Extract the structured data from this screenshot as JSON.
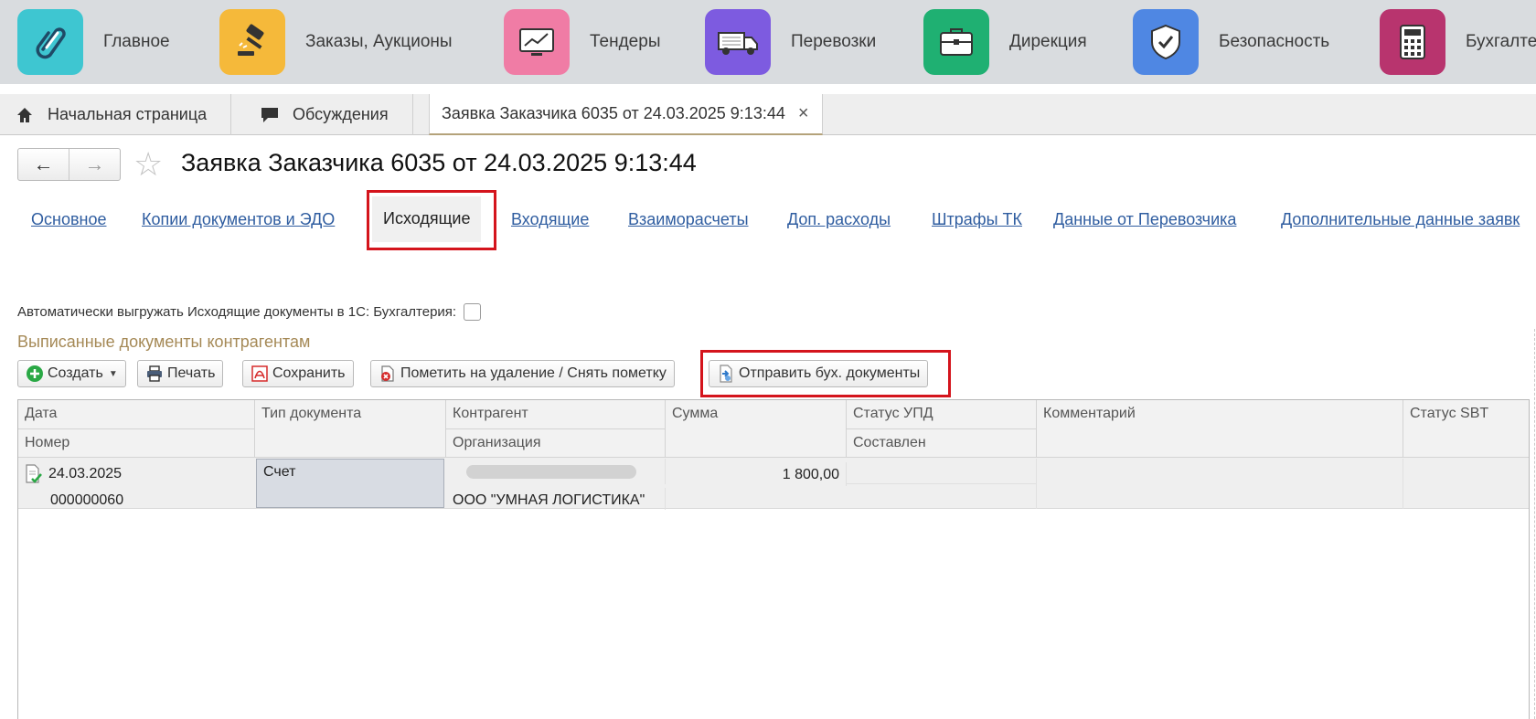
{
  "sections": [
    {
      "label": "Главное",
      "icon": "paperclip-icon",
      "color": "#3ec6d1"
    },
    {
      "label": "Заказы, Аукционы",
      "icon": "gavel-icon",
      "color": "#f5b93a"
    },
    {
      "label": "Тендеры",
      "icon": "chart-monitor-icon",
      "color": "#f07ca5"
    },
    {
      "label": "Перевозки",
      "icon": "truck-icon",
      "color": "#7d5be0"
    },
    {
      "label": "Дирекция",
      "icon": "briefcase-icon",
      "color": "#1fb072"
    },
    {
      "label": "Безопасность",
      "icon": "shield-check-icon",
      "color": "#4f87e3"
    },
    {
      "label": "Бухгалте",
      "icon": "calculator-icon",
      "color": "#b8346e"
    }
  ],
  "window_tabs": {
    "home": "Начальная страница",
    "discussions": "Обсуждения",
    "current": "Заявка Заказчика 6035 от 24.03.2025 9:13:44",
    "close": "×"
  },
  "title": "Заявка Заказчика 6035 от 24.03.2025 9:13:44",
  "nav": {
    "back": "←",
    "forward": "→",
    "star": "☆"
  },
  "form_tabs": [
    "Основное",
    "Копии документов и ЭДО",
    "Исходящие",
    "Входящие",
    "Взаиморасчеты",
    "Доп. расходы",
    "Штрафы ТК",
    "Данные от Перевозчика",
    "Дополнительные данные заявк"
  ],
  "active_tab": "Исходящие",
  "auto_export_label": "Автоматически выгружать Исходящие документы в 1С: Бухгалтерия:",
  "auto_export_checked": false,
  "group_title": "Выписанные документы контрагентам",
  "toolbar": {
    "create": "Создать",
    "print": "Печать",
    "save": "Сохранить",
    "mark_delete": "Пометить на удаление / Снять пометку",
    "send": "Отправить бух. документы"
  },
  "table": {
    "headers_row1": [
      "Дата",
      "Тип документа",
      "Контрагент",
      "Сумма",
      "Статус УПД",
      "Комментарий",
      "Статус SBT"
    ],
    "headers_row2": [
      "Номер",
      "",
      "Организация",
      "",
      "Составлен",
      "",
      ""
    ],
    "rows": [
      {
        "date": "24.03.2025",
        "number": "000000060",
        "doc_type": "Счет",
        "counterparty": "",
        "organization": "ООО \"УМНАЯ ЛОГИСТИКА\"",
        "sum": "1 800,00",
        "upd_status": "",
        "composed": "",
        "comment": "",
        "sbt_status": ""
      }
    ]
  },
  "colors": {
    "highlight": "#d4141c",
    "link": "#2f5da0",
    "group_title": "#a58956"
  }
}
